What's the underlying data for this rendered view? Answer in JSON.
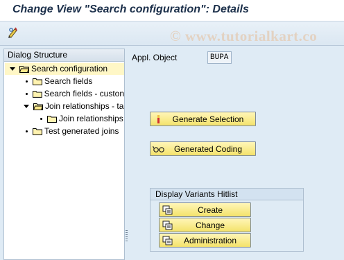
{
  "window": {
    "title": "Change View \"Search configuration\": Details"
  },
  "watermark": "© www.tutorialkart.co",
  "toolbar": {
    "icons": [
      "display-change-icon"
    ]
  },
  "dialog_structure": {
    "header": "Dialog Structure",
    "items": [
      {
        "label": "Search configuration",
        "level": 0,
        "expanded": true,
        "selected": true
      },
      {
        "label": "Search fields",
        "level": 1
      },
      {
        "label": "Search fields - custon",
        "level": 1
      },
      {
        "label": "Join relationships - ta",
        "level": 1,
        "expanded": true
      },
      {
        "label": "Join relationships",
        "level": 2
      },
      {
        "label": "Test generated joins",
        "level": 1
      }
    ]
  },
  "fields": {
    "appl_object_label": "Appl. Object",
    "appl_object_value": "BUPA"
  },
  "buttons": {
    "generate_selection": "Generate Selection",
    "generated_coding": "Generated Coding"
  },
  "display_variants": {
    "title": "Display Variants Hitlist",
    "create": "Create",
    "change": "Change",
    "administration": "Administration"
  },
  "colors": {
    "button_fill": "#f4e26b",
    "selected_row": "#fff7c6",
    "background": "#dfebf5"
  }
}
